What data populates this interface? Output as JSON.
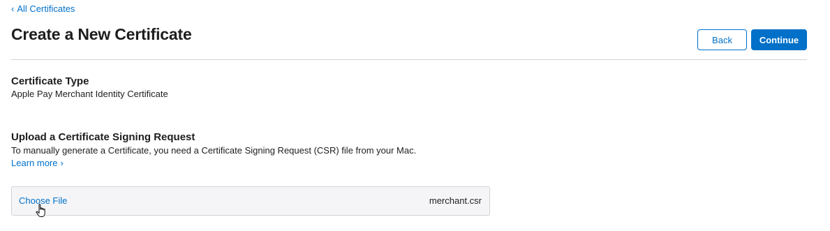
{
  "nav": {
    "back_link_label": "All Certificates",
    "back_chevron": "‹"
  },
  "header": {
    "title": "Create a New Certificate",
    "back_button_label": "Back",
    "continue_button_label": "Continue"
  },
  "certificate_type": {
    "heading": "Certificate Type",
    "value": "Apple Pay Merchant Identity Certificate"
  },
  "csr_upload": {
    "heading": "Upload a Certificate Signing Request",
    "description": "To manually generate a Certificate, you need a Certificate Signing Request (CSR) file from your Mac.",
    "learn_more_label": "Learn more",
    "learn_more_chevron": "›",
    "choose_file_label": "Choose File",
    "selected_file_name": "merchant.csr"
  },
  "colors": {
    "accent": "#0070c9",
    "text": "#1d1d1f",
    "divider": "#d2d2d7",
    "file_box_bg": "#f5f5f7"
  },
  "icons": {
    "pointer": "hand-pointer-icon"
  }
}
